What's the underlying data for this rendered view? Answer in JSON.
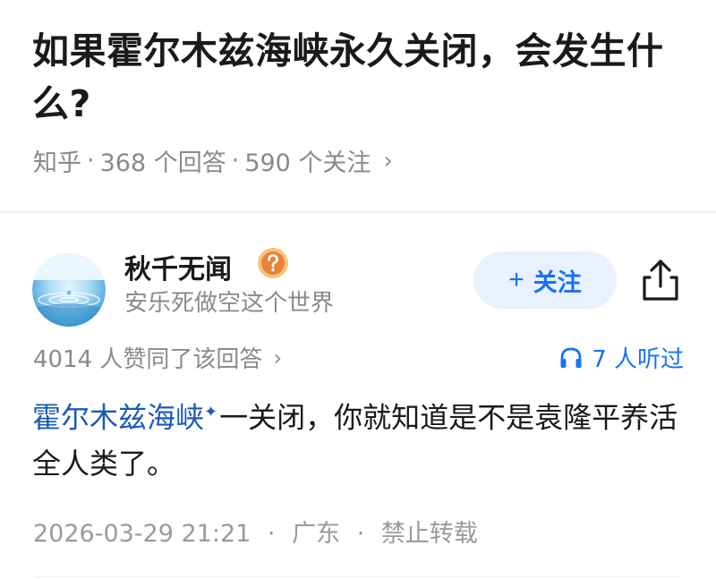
{
  "question": {
    "title": "如果霍尔木兹海峡永久关闭，会发生什么?",
    "source": "知乎",
    "answers_count": "368 个回答",
    "followers_count": "590 个关注",
    "separator": "·",
    "chevron": "›"
  },
  "author": {
    "name": "秋千无闻",
    "bio": "安乐死做空这个世界",
    "badge_icon": "question-badge-icon",
    "follow_label": "关注",
    "follow_plus": "+"
  },
  "answer_meta": {
    "upvotes": "4014 人赞同了该回答",
    "chevron": "›",
    "listeners": "7 人听过"
  },
  "answer": {
    "link_text": "霍尔木兹海峡",
    "spark": "✦",
    "text": "一关闭，你就知道是不是袁隆平养活全人类了。"
  },
  "footer": {
    "datetime": "2026-03-29 21:21",
    "location": "广东",
    "copyright": "禁止转载",
    "separator": "·"
  },
  "colors": {
    "accent": "#1772f6",
    "link": "#1a5ab8",
    "muted": "#8a8a8a",
    "badge": "#e8823a"
  }
}
